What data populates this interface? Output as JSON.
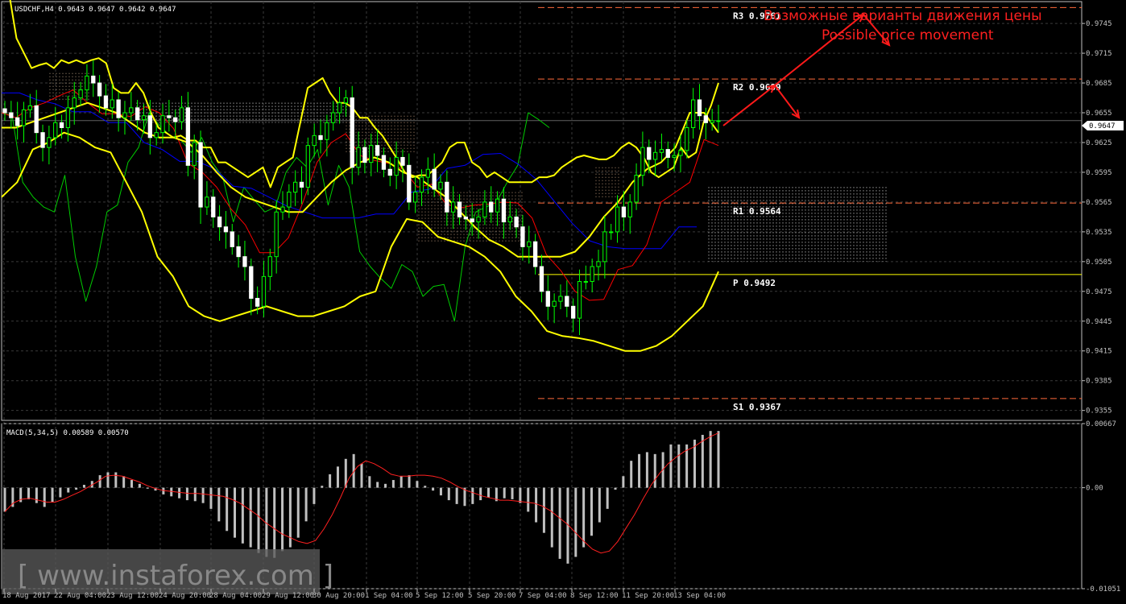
{
  "window": {
    "symbol_label": "USDCHF,H4  0.9643 0.9647 0.9642 0.9647",
    "current_price": "0.9647"
  },
  "annotation": {
    "line1": "Возможные варианты движения цены",
    "line2": "Possible price movement"
  },
  "watermark": "[ www.instaforex.com ]",
  "colors": {
    "background": "#000000",
    "grid": "#3a3a3a",
    "axis": "#c0c0c0",
    "bollinger": "#ffff00",
    "chikou": "#00cc00",
    "tenkan": "#ff0000",
    "kijun": "#0000ff",
    "pivot_dashed": "#ff6a3a",
    "pivot_solid": "#ffff00",
    "macd_hist": "#c0c0c0",
    "macd_signal": "#ff2020",
    "arrows": "#ff1a1a",
    "candles": "#00ff00"
  },
  "chart_data": [
    {
      "type": "candlestick",
      "title": "USDCHF,H4  0.9643 0.9647 0.9642 0.9647",
      "ylim": [
        0.9345,
        0.9767
      ],
      "y_ticks": [
        "0.9745",
        "0.9715",
        "0.9685",
        "0.9655",
        "0.9625",
        "0.9595",
        "0.9565",
        "0.9535",
        "0.9505",
        "0.9475",
        "0.9445",
        "0.9415",
        "0.9385",
        "0.9355"
      ],
      "x_ticks": [
        "18 Aug 2017",
        "22 Aug 04:00",
        "23 Aug 12:00",
        "24 Aug 20:00",
        "28 Aug 04:00",
        "29 Aug 12:00",
        "30 Aug 20:00",
        "1 Sep 04:00",
        "5 Sep 12:00",
        "5 Sep 20:00",
        "7 Sep 04:00",
        "8 Sep 12:00",
        "11 Sep 20:00",
        "13 Sep 04:00"
      ],
      "grid": true,
      "legend": "none",
      "pivot_levels": [
        {
          "name": "R3",
          "label": "R3  0.9761",
          "value": 0.9761,
          "style": "dashed"
        },
        {
          "name": "R2",
          "label": "R2  0.9689",
          "value": 0.9689,
          "style": "dashed"
        },
        {
          "name": "R1",
          "label": "R1  0.9564",
          "value": 0.9564,
          "style": "dashed"
        },
        {
          "name": "P",
          "label": "P  0.9492",
          "value": 0.9492,
          "style": "solid"
        },
        {
          "name": "S1",
          "label": "S1  0.9367",
          "value": 0.9367,
          "style": "dashed"
        }
      ],
      "current_price": 0.9647,
      "series": [
        {
          "name": "close",
          "values": [
            0.9655,
            0.965,
            0.9642,
            0.9658,
            0.9662,
            0.9635,
            0.962,
            0.963,
            0.9645,
            0.964,
            0.966,
            0.967,
            0.9678,
            0.9692,
            0.9685,
            0.9672,
            0.966,
            0.9668,
            0.965,
            0.9655,
            0.966,
            0.9648,
            0.9652,
            0.963,
            0.9635,
            0.9652,
            0.965,
            0.9646,
            0.966,
            0.9602,
            0.9625,
            0.956,
            0.957,
            0.955,
            0.954,
            0.9535,
            0.952,
            0.951,
            0.95,
            0.9468,
            0.946,
            0.949,
            0.951,
            0.9555,
            0.956,
            0.9575,
            0.9585,
            0.958,
            0.9622,
            0.9632,
            0.9628,
            0.9645,
            0.9655,
            0.9665,
            0.967,
            0.96,
            0.962,
            0.9605,
            0.9622,
            0.9612,
            0.9598,
            0.9592,
            0.961,
            0.9602,
            0.9565,
            0.9575,
            0.959,
            0.9598,
            0.9578,
            0.9585,
            0.9555,
            0.9565,
            0.955,
            0.9548,
            0.9545,
            0.955,
            0.9565,
            0.9555,
            0.9568,
            0.9545,
            0.955,
            0.954,
            0.952,
            0.9525,
            0.95,
            0.9475,
            0.946,
            0.9465,
            0.947,
            0.946,
            0.9448,
            0.9485,
            0.9485,
            0.95,
            0.9505,
            0.9535,
            0.9535,
            0.956,
            0.955,
            0.9565,
            0.9592,
            0.962,
            0.9608,
            0.9615,
            0.9618,
            0.961,
            0.9612,
            0.9617,
            0.964,
            0.9668,
            0.9652,
            0.9645,
            0.9647,
            0.9647
          ]
        },
        {
          "name": "bollinger_upper",
          "values": [
            0.9795,
            0.9775,
            0.973,
            0.9715,
            0.97,
            0.9703,
            0.9705,
            0.97,
            0.9708,
            0.9705,
            0.9708,
            0.9705,
            0.9708,
            0.971,
            0.9705,
            0.968,
            0.9675,
            0.9675,
            0.9685,
            0.9675,
            0.9655,
            0.964,
            0.9635,
            0.963,
            0.9632,
            0.9627,
            0.9627,
            0.962,
            0.962,
            0.9605,
            0.9605,
            0.96,
            0.9595,
            0.959,
            0.9595,
            0.96,
            0.958,
            0.96,
            0.9605,
            0.961,
            0.9645,
            0.968,
            0.9685,
            0.969,
            0.9675,
            0.9665,
            0.9665,
            0.966,
            0.965,
            0.965,
            0.964,
            0.9632,
            0.962,
            0.9608,
            0.9595,
            0.959,
            0.9592,
            0.9592,
            0.9598,
            0.9605,
            0.962,
            0.9625,
            0.9625,
            0.9605,
            0.96,
            0.959,
            0.9595,
            0.959,
            0.9585,
            0.9585,
            0.9585,
            0.9585,
            0.959,
            0.959,
            0.9592,
            0.96,
            0.9605,
            0.961,
            0.9612,
            0.961,
            0.9608,
            0.9608,
            0.9612,
            0.962,
            0.9625,
            0.962,
            0.961,
            0.9595,
            0.959,
            0.9595,
            0.96,
            0.962,
            0.961,
            0.9615,
            0.9645,
            0.9662,
            0.9685
          ]
        },
        {
          "name": "bollinger_middle",
          "values": [
            0.964,
            0.964,
            0.9645,
            0.965,
            0.9655,
            0.966,
            0.9665,
            0.966,
            0.9655,
            0.9645,
            0.9635,
            0.963,
            0.963,
            0.9625,
            0.9612,
            0.9595,
            0.958,
            0.957,
            0.9565,
            0.956,
            0.9555,
            0.9555,
            0.957,
            0.9585,
            0.9597,
            0.9605,
            0.961,
            0.9605,
            0.9595,
            0.959,
            0.958,
            0.957,
            0.9555,
            0.954,
            0.9527,
            0.952,
            0.951,
            0.951,
            0.951,
            0.951,
            0.9515,
            0.953,
            0.955,
            0.9565,
            0.9585,
            0.9598,
            0.9605,
            0.962,
            0.9655,
            0.9655,
            0.9635
          ]
        },
        {
          "name": "bollinger_lower",
          "values": [
            0.957,
            0.9585,
            0.9618,
            0.9625,
            0.9635,
            0.963,
            0.962,
            0.9615,
            0.9585,
            0.9555,
            0.951,
            0.949,
            0.946,
            0.945,
            0.9445,
            0.945,
            0.9455,
            0.946,
            0.9455,
            0.945,
            0.945,
            0.9455,
            0.946,
            0.947,
            0.9475,
            0.952,
            0.9548,
            0.9545,
            0.953,
            0.9525,
            0.952,
            0.951,
            0.9495,
            0.947,
            0.9455,
            0.9435,
            0.943,
            0.9428,
            0.9425,
            0.942,
            0.9415,
            0.9415,
            0.942,
            0.943,
            0.9445,
            0.946,
            0.9495
          ]
        },
        {
          "name": "tenkan",
          "values": [
            0.9655,
            0.965,
            0.966,
            0.9665,
            0.9672,
            0.9678,
            0.9665,
            0.9654,
            0.9654,
            0.9651,
            0.9661,
            0.9655,
            0.9639,
            0.9604,
            0.9595,
            0.958,
            0.9558,
            0.9542,
            0.9514,
            0.9514,
            0.9529,
            0.9564,
            0.9605,
            0.9625,
            0.9634,
            0.9612,
            0.9607,
            0.9604,
            0.9598,
            0.958,
            0.9583,
            0.9563,
            0.9559,
            0.9562,
            0.9563,
            0.9565,
            0.9564,
            0.9549,
            0.9512,
            0.9496,
            0.9475,
            0.9466,
            0.9467,
            0.9497,
            0.9501,
            0.9522,
            0.9565,
            0.9575,
            0.9585,
            0.9628,
            0.9622
          ]
        },
        {
          "name": "kijun",
          "values": [
            0.9675,
            0.9675,
            0.9668,
            0.9664,
            0.9656,
            0.9656,
            0.9645,
            0.9645,
            0.9625,
            0.9618,
            0.9606,
            0.9606,
            0.9598,
            0.9581,
            0.9579,
            0.957,
            0.9561,
            0.9555,
            0.9549,
            0.9549,
            0.9549,
            0.9553,
            0.9553,
            0.9575,
            0.9578,
            0.9599,
            0.9602,
            0.9613,
            0.9614,
            0.9603,
            0.9588,
            0.9566,
            0.9544,
            0.9526,
            0.952,
            0.9518,
            0.9518,
            0.9518,
            0.954,
            0.954
          ]
        },
        {
          "name": "chikou",
          "values": [
            0.9655,
            0.9652,
            0.9585,
            0.957,
            0.956,
            0.9555,
            0.9592,
            0.951,
            0.9465,
            0.95,
            0.9555,
            0.9562,
            0.9605,
            0.962,
            0.9655,
            0.9642,
            0.9632,
            0.9628,
            0.9615,
            0.963,
            0.9605,
            0.959,
            0.9545,
            0.958,
            0.9567,
            0.9555,
            0.956,
            0.9595,
            0.961,
            0.96,
            0.9618,
            0.9562,
            0.9602,
            0.958,
            0.9515,
            0.95,
            0.9488,
            0.9478,
            0.9502,
            0.9495,
            0.947,
            0.948,
            0.9482,
            0.9445,
            0.952,
            0.9555,
            0.956,
            0.9565,
            0.9585,
            0.9602,
            0.9655,
            0.9648,
            0.964
          ]
        }
      ]
    },
    {
      "type": "bar",
      "title": "MACD(5,34,5) 0.00589 0.00570",
      "ylim": [
        -0.01051,
        0.00667
      ],
      "y_ticks": [
        "0.00667",
        "0.00",
        "-0.01051"
      ],
      "grid": true,
      "legend": "none",
      "series": [
        {
          "name": "histogram",
          "values": [
            -0.0025,
            -0.002,
            -0.0015,
            -0.0012,
            -0.0016,
            -0.002,
            -0.0015,
            -0.001,
            -0.0005,
            -0.0002,
            0.0003,
            0.0007,
            0.0013,
            0.0016,
            0.0016,
            0.0012,
            0.0008,
            0.0004,
            -0.0001,
            -0.0003,
            -0.0007,
            -0.0009,
            -0.0011,
            -0.0013,
            -0.0014,
            -0.0016,
            -0.0022,
            -0.0035,
            -0.0045,
            -0.0052,
            -0.0058,
            -0.0062,
            -0.0068,
            -0.0072,
            -0.0073,
            -0.0066,
            -0.0062,
            -0.0052,
            -0.0035,
            -0.0017,
            0.0002,
            0.0014,
            0.0022,
            0.003,
            0.0035,
            0.0025,
            0.0012,
            0.0006,
            0.0004,
            0.0008,
            0.0012,
            0.0013,
            0.0007,
            0.0002,
            -0.0003,
            -0.0008,
            -0.0013,
            -0.0017,
            -0.0019,
            -0.0017,
            -0.0013,
            -0.001,
            -0.0014,
            -0.0011,
            -0.0012,
            -0.0016,
            -0.0025,
            -0.0036,
            -0.0047,
            -0.0062,
            -0.0074,
            -0.0079,
            -0.0072,
            -0.0062,
            -0.005,
            -0.0036,
            -0.0022,
            -0.0002,
            0.0012,
            0.0028,
            0.0035,
            0.0037,
            0.0035,
            0.0037,
            0.0045,
            0.0045,
            0.0045,
            0.005,
            0.0055,
            0.0059,
            0.0059
          ]
        },
        {
          "name": "signal",
          "values": [
            -0.0025,
            -0.0016,
            -0.0012,
            -0.0011,
            -0.0013,
            -0.0015,
            -0.0015,
            -0.0012,
            -0.0008,
            -0.0004,
            0.0001,
            0.0006,
            0.0012,
            0.0013,
            0.0012,
            0.0009,
            0.0006,
            0.0002,
            -0.0001,
            -0.0003,
            -0.0004,
            -0.0005,
            -0.0006,
            -0.0006,
            -0.0007,
            -0.0008,
            -0.0009,
            -0.0012,
            -0.0016,
            -0.0022,
            -0.0028,
            -0.0036,
            -0.0042,
            -0.0048,
            -0.0052,
            -0.0056,
            -0.0058,
            -0.0055,
            -0.0043,
            -0.0028,
            -0.001,
            0.001,
            0.0022,
            0.0028,
            0.0025,
            0.002,
            0.0014,
            0.0012,
            0.0012,
            0.0013,
            0.0013,
            0.0012,
            0.001,
            0.0006,
            0.0001,
            -0.0003,
            -0.0006,
            -0.0009,
            -0.0011,
            -0.0013,
            -0.0013,
            -0.0014,
            -0.0015,
            -0.0016,
            -0.0019,
            -0.0024,
            -0.0031,
            -0.0038,
            -0.0047,
            -0.0056,
            -0.0064,
            -0.0068,
            -0.0066,
            -0.0056,
            -0.0042,
            -0.0028,
            -0.0012,
            0.0003,
            0.0015,
            0.0025,
            0.0032,
            0.0038,
            0.0042,
            0.0048,
            0.0053,
            0.0057
          ]
        }
      ]
    }
  ]
}
